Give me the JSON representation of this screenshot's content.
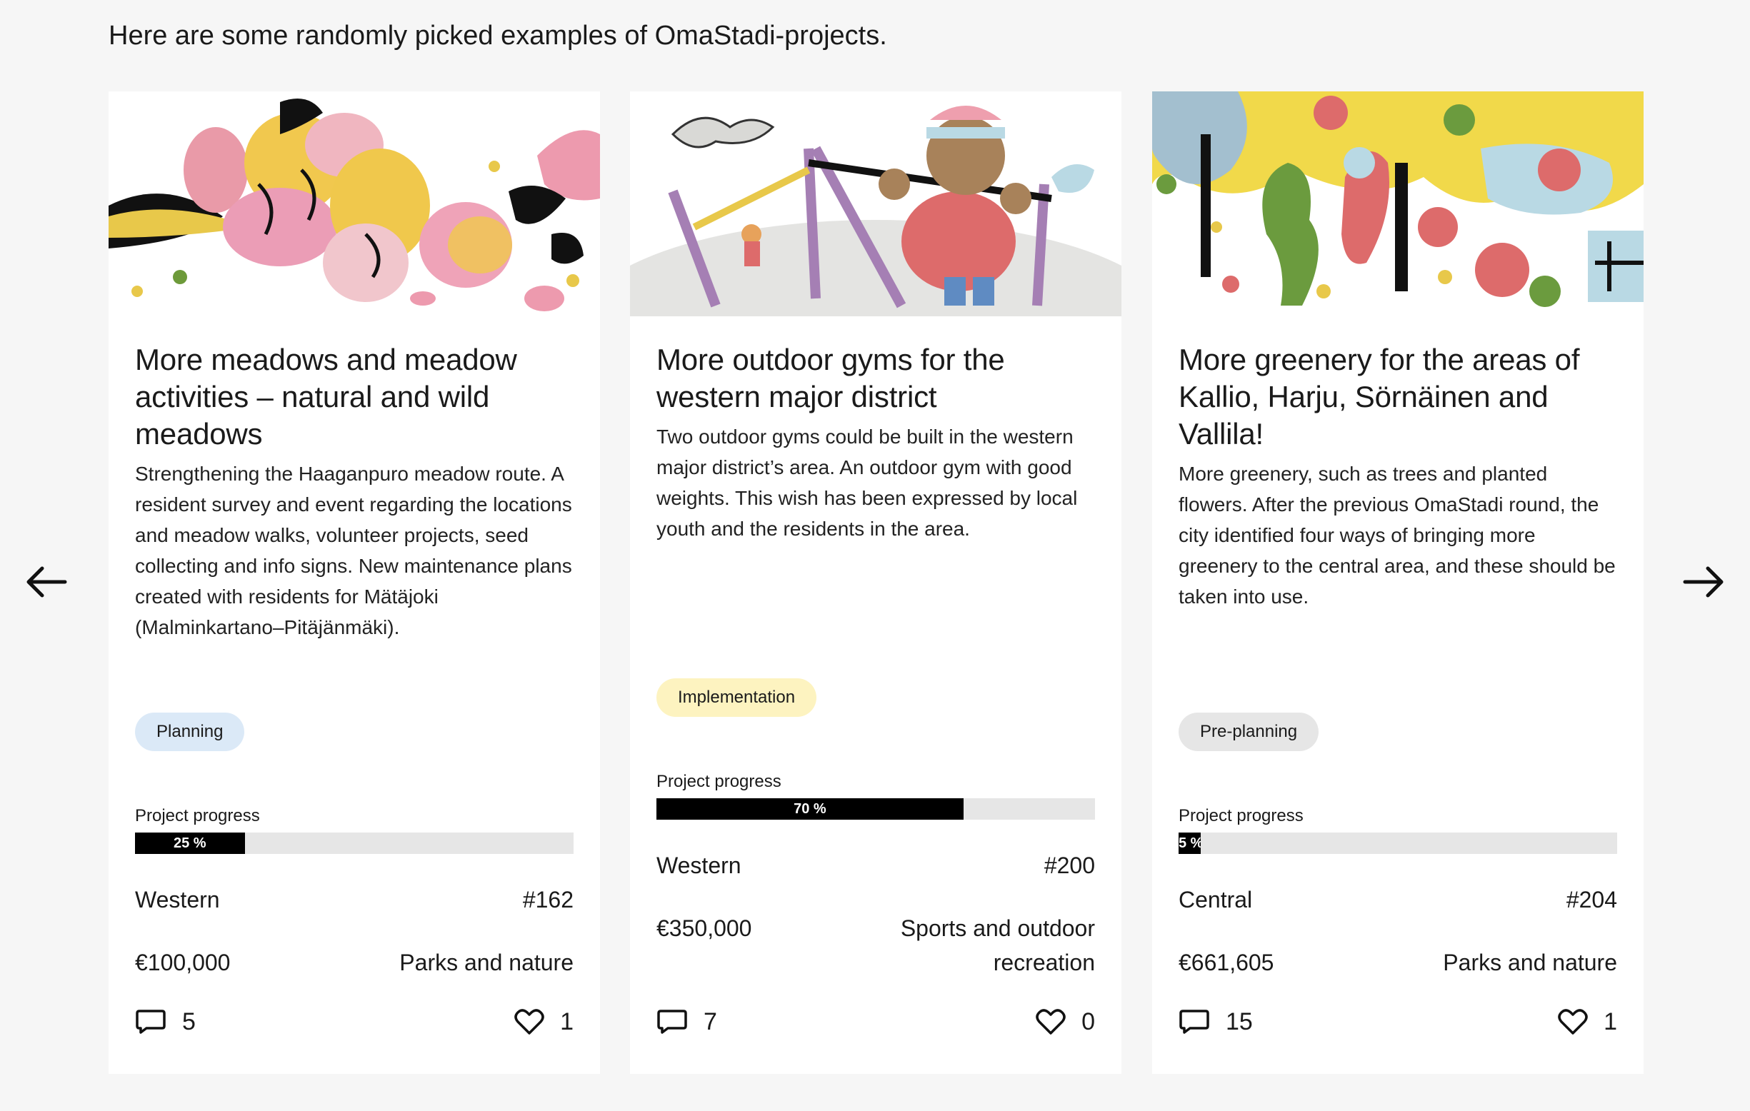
{
  "intro": "Here are some randomly picked examples of OmaStadi-projects.",
  "nav": {
    "prev_icon": "arrow-left-icon",
    "next_icon": "arrow-right-icon"
  },
  "cards": [
    {
      "title": "More meadows and meadow activities – natural and wild meadows",
      "description": "Strengthening the Haaganpuro meadow route. A resident survey and event regarding the locations and meadow walks, volunteer projects, seed collecting and info signs. New maintenance plans created with residents for Mätäjoki (Malminkartano–Pitäjänmäki).",
      "status": "Planning",
      "status_color": "#dbe9f7",
      "progress_label": "Project progress",
      "progress_value": 25,
      "progress_text": "25 %",
      "district": "Western",
      "number": "#162",
      "budget": "€100,000",
      "category": "Parks and nature",
      "comments": "5",
      "likes": "1",
      "comment_icon": "comment-icon",
      "like_icon": "heart-icon"
    },
    {
      "title": "More outdoor gyms for the western major district",
      "description": "Two outdoor gyms could be built in the western major district’s area. An outdoor gym with good weights. This wish has been expressed by local youth and the residents in the area.",
      "status": "Implementation",
      "status_color": "#fdf3c0",
      "progress_label": "Project progress",
      "progress_value": 70,
      "progress_text": "70 %",
      "district": "Western",
      "number": "#200",
      "budget": "€350,000",
      "category": "Sports and outdoor recreation",
      "comments": "7",
      "likes": "0",
      "comment_icon": "comment-icon",
      "like_icon": "heart-icon"
    },
    {
      "title": "More greenery for the areas of Kallio, Harju, Sörnäinen and Vallila!",
      "description": "More greenery, such as trees and planted flowers. After the previous OmaStadi round, the city identified four ways of bringing more greenery to the central area, and these should be taken into use.",
      "status": "Pre-planning",
      "status_color": "#e6e6e6",
      "progress_label": "Project progress",
      "progress_value": 5,
      "progress_text": "5 %",
      "district": "Central",
      "number": "#204",
      "budget": "€661,605",
      "category": "Parks and nature",
      "comments": "15",
      "likes": "1",
      "comment_icon": "comment-icon",
      "like_icon": "heart-icon"
    }
  ]
}
